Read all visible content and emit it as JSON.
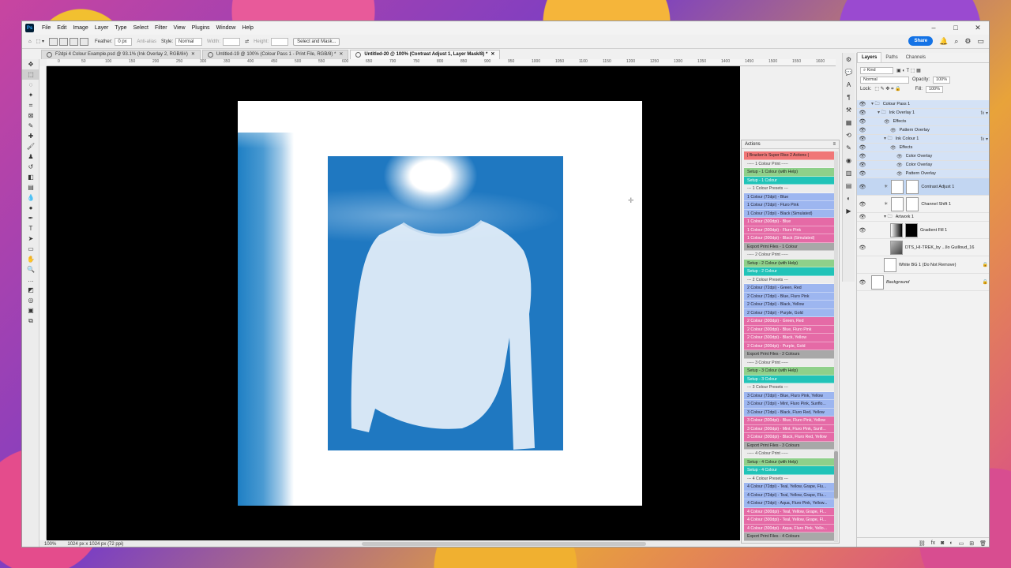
{
  "menubar": {
    "items": [
      "File",
      "Edit",
      "Image",
      "Layer",
      "Type",
      "Select",
      "Filter",
      "View",
      "Plugins",
      "Window",
      "Help"
    ],
    "logo": "Ps"
  },
  "options": {
    "feather_label": "Feather:",
    "feather_value": "0 px",
    "antialias_label": "Anti-alias",
    "style_label": "Style:",
    "style_value": "Normal",
    "width_label": "Width:",
    "height_label": "Height:",
    "select_mask": "Select and Mask...",
    "share": "Share"
  },
  "tabs": [
    {
      "label": "F2dpi 4 Colour Example.psd @ 93.1% (Ink Overlay 2, RGB/8#)",
      "active": false
    },
    {
      "label": "Untitled-19 @ 100% (Colour Pass 1 - Print File, RGB/8) *",
      "active": false
    },
    {
      "label": "Untitled-20 @ 100% (Contrast Adjust 1, Layer Mask/8) *",
      "active": true
    }
  ],
  "ruler": [
    "0",
    "50",
    "100",
    "150",
    "200",
    "250",
    "300",
    "350",
    "400",
    "450",
    "500",
    "550",
    "600",
    "650",
    "700",
    "750",
    "800",
    "850",
    "900",
    "950",
    "1000",
    "1050",
    "1100",
    "1150",
    "1200",
    "1250",
    "1300",
    "1350",
    "1400",
    "1450",
    "1500",
    "1550",
    "1600"
  ],
  "status": {
    "zoom": "100%",
    "doc_info": "1024 px x 1024 px (72 ppi)"
  },
  "actions": {
    "title": "Actions",
    "items": [
      {
        "label": "| Bracken's Super Riso 2 Actions |",
        "color": "red"
      },
      {
        "label": "----- 1 Colour Print -----",
        "color": "sep"
      },
      {
        "label": "Setup - 1 Colour (with Help)",
        "color": "green"
      },
      {
        "label": "Setup - 1 Colour",
        "color": "teal"
      },
      {
        "label": "--- 1 Colour Presets ---",
        "color": "sep"
      },
      {
        "label": "1 Colour (72dpi) - Blue",
        "color": "blue"
      },
      {
        "label": "1 Colour (72dpi) - Fluro Pink",
        "color": "blue"
      },
      {
        "label": "1 Colour (72dpi) - Black (Simulated)",
        "color": "blue"
      },
      {
        "label": "1 Colour (300dpi) - Blue",
        "color": "pink"
      },
      {
        "label": "1 Colour (300dpi) - Fluro Pink",
        "color": "pink"
      },
      {
        "label": "1 Colour (300dpi) - Black (Simulated)",
        "color": "pink"
      },
      {
        "label": "Export Print Files - 1 Colour",
        "color": "grey"
      },
      {
        "label": "----- 2 Colour Print -----",
        "color": "sep"
      },
      {
        "label": "Setup - 2 Colour (with Help)",
        "color": "green"
      },
      {
        "label": "Setup - 2 Colour",
        "color": "teal"
      },
      {
        "label": "--- 2 Colour Presets ---",
        "color": "sep"
      },
      {
        "label": "2 Colour (72dpi) - Green, Red",
        "color": "blue"
      },
      {
        "label": "2 Colour (72dpi) - Blue, Fluro Pink",
        "color": "blue"
      },
      {
        "label": "2 Colour (72dpi) - Black, Yellow",
        "color": "blue"
      },
      {
        "label": "2 Colour (72dpi) - Purple, Gold",
        "color": "blue"
      },
      {
        "label": "2 Colour (300dpi) - Green, Red",
        "color": "pink"
      },
      {
        "label": "2 Colour (300dpi) - Blue, Fluro Pink",
        "color": "pink"
      },
      {
        "label": "2 Colour (300dpi) - Black, Yellow",
        "color": "pink"
      },
      {
        "label": "2 Colour (300dpi) - Purple, Gold",
        "color": "pink"
      },
      {
        "label": "Export Print Files - 2 Colours",
        "color": "grey"
      },
      {
        "label": "----- 3 Colour Print -----",
        "color": "sep"
      },
      {
        "label": "Setup - 3 Colour (with Help)",
        "color": "green"
      },
      {
        "label": "Setup - 3 Colour",
        "color": "teal"
      },
      {
        "label": "--- 3 Colour Presets ---",
        "color": "sep"
      },
      {
        "label": "3 Colour (72dpi) - Blue, Fluro Pink, Yellow",
        "color": "blue"
      },
      {
        "label": "3 Colour (72dpi) - Mint, Fluro Pink, Sunflo...",
        "color": "blue"
      },
      {
        "label": "3 Colour (72dpi) - Black, Fluro Red, Yellow",
        "color": "blue"
      },
      {
        "label": "3 Colour (300dpi) - Blue, Fluro Pink, Yellow",
        "color": "pink"
      },
      {
        "label": "3 Colour (300dpi) - Mint, Fluro Pink, Sunfl...",
        "color": "pink"
      },
      {
        "label": "3 Colour (300dpi) - Black, Fluro Red, Yellow",
        "color": "pink"
      },
      {
        "label": "Export Print Files - 3 Colours",
        "color": "grey"
      },
      {
        "label": "----- 4 Colour Print -----",
        "color": "sep"
      },
      {
        "label": "Setup - 4 Colour (with Help)",
        "color": "green"
      },
      {
        "label": "Setup - 4 Colour",
        "color": "teal"
      },
      {
        "label": "--- 4 Colour Presets ---",
        "color": "sep"
      },
      {
        "label": "4 Colour (72dpi) - Teal, Yellow, Grape, Flu...",
        "color": "blue"
      },
      {
        "label": "4 Colour (72dpi) - Teal, Yellow, Grape, Flu...",
        "color": "blue"
      },
      {
        "label": "4 Colour (72dpi) - Aqua, Fluro Pink, Yellow...",
        "color": "blue"
      },
      {
        "label": "4 Colour (300dpi) - Teal, Yellow, Grape, Fl...",
        "color": "pink"
      },
      {
        "label": "4 Colour (300dpi) - Teal, Yellow, Grape, Fl...",
        "color": "pink"
      },
      {
        "label": "4 Colour (300dpi) - Aqua, Fluro Pink, Yello...",
        "color": "pink"
      },
      {
        "label": "Export Print Files - 4 Colours",
        "color": "grey"
      }
    ]
  },
  "layers_panel": {
    "tabs": [
      "Layers",
      "Paths",
      "Channels"
    ],
    "kind": "Kind",
    "blend": "Normal",
    "opacity_label": "Opacity:",
    "opacity": "100%",
    "lock_label": "Lock:",
    "fill_label": "Fill:",
    "fill": "100%",
    "layers": [
      {
        "name": "Colour Pass 1",
        "type": "group",
        "visible": true,
        "indent": 0
      },
      {
        "name": "Ink Overlay 1",
        "type": "group",
        "visible": true,
        "indent": 1,
        "fx": true
      },
      {
        "name": "Effects",
        "type": "effect",
        "visible": true,
        "indent": 2
      },
      {
        "name": "Pattern Overlay",
        "type": "effect",
        "visible": true,
        "indent": 3
      },
      {
        "name": "Ink Colour 1",
        "type": "group",
        "visible": true,
        "indent": 2,
        "fx": true
      },
      {
        "name": "Effects",
        "type": "effect",
        "visible": true,
        "indent": 3
      },
      {
        "name": "Color Overlay",
        "type": "effect",
        "visible": true,
        "indent": 4
      },
      {
        "name": "Color Overlay",
        "type": "effect",
        "visible": true,
        "indent": 4
      },
      {
        "name": "Pattern Overlay",
        "type": "effect",
        "visible": true,
        "indent": 4
      },
      {
        "name": "Contrast Adjust 1",
        "type": "adjust",
        "visible": true,
        "indent": 2,
        "selected": true
      },
      {
        "name": "Channel Shift 1",
        "type": "adjust",
        "visible": true,
        "indent": 2
      },
      {
        "name": "Artwork 1",
        "type": "group",
        "visible": true,
        "indent": 2
      },
      {
        "name": "Gradient Fill 1",
        "type": "gradient",
        "visible": true,
        "indent": 3
      },
      {
        "name": "DTS_HI-TREK_by ...llo Guilloud_16",
        "type": "photo",
        "visible": true,
        "indent": 3
      },
      {
        "name": "White BG 1 (Do Not Remove)",
        "type": "plain",
        "visible": false,
        "indent": 2,
        "locked": true
      },
      {
        "name": "Background",
        "type": "plain",
        "visible": true,
        "indent": 0,
        "locked": true,
        "italic": true
      }
    ]
  },
  "colors": {
    "accent": "#1473e6",
    "print_blue": "#1f78c1"
  }
}
